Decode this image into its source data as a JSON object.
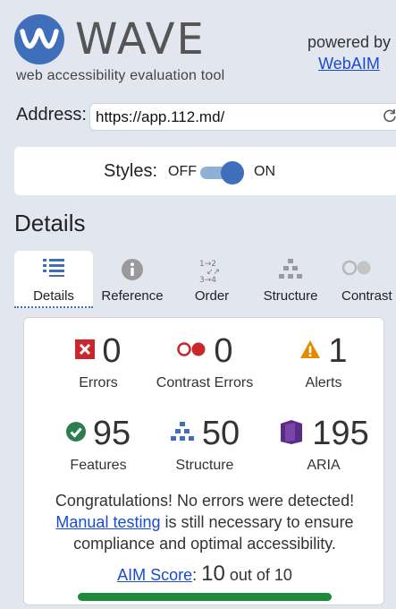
{
  "header": {
    "app_name": "WAVE",
    "tagline": "web accessibility evaluation tool",
    "powered_by": "powered by",
    "webaim_link": "WebAIM"
  },
  "address": {
    "label": "Address:",
    "value": "https://app.112.md/"
  },
  "styles": {
    "label": "Styles:",
    "off_label": "OFF",
    "on_label": "ON",
    "state": "on"
  },
  "details": {
    "title": "Details",
    "tabs": [
      {
        "label": "Details",
        "icon": "list-icon",
        "active": true
      },
      {
        "label": "Reference",
        "icon": "info-icon",
        "active": false
      },
      {
        "label": "Order",
        "icon": "order-icon",
        "active": false
      },
      {
        "label": "Structure",
        "icon": "structure-icon",
        "active": false
      },
      {
        "label": "Contrast",
        "icon": "contrast-icon",
        "active": false
      }
    ]
  },
  "summary": {
    "errors": {
      "count": "0",
      "label": "Errors"
    },
    "contrast_errors": {
      "count": "0",
      "label": "Contrast Errors"
    },
    "alerts": {
      "count": "1",
      "label": "Alerts"
    },
    "features": {
      "count": "95",
      "label": "Features"
    },
    "structure": {
      "count": "50",
      "label": "Structure"
    },
    "aria": {
      "count": "195",
      "label": "ARIA"
    },
    "congrats_line1": "Congratulations! No errors were detected!",
    "manual_testing_link": "Manual testing",
    "congrats_line2_rest": " is still necessary to ensure",
    "congrats_line3": "compliance and optimal accessibility.",
    "aim_link": "AIM Score",
    "aim_colon": ":",
    "aim_value": "10",
    "aim_suffix": "out of 10",
    "aim_fraction": 1.0
  },
  "colors": {
    "brand_blue": "#3f6ebb",
    "error_red": "#c8272d",
    "alert_orange": "#e38b00",
    "feature_green": "#2e7d4f",
    "aria_purple": "#5b2c83",
    "score_green": "#1f8a3a",
    "link_blue": "#1a4bd0"
  }
}
